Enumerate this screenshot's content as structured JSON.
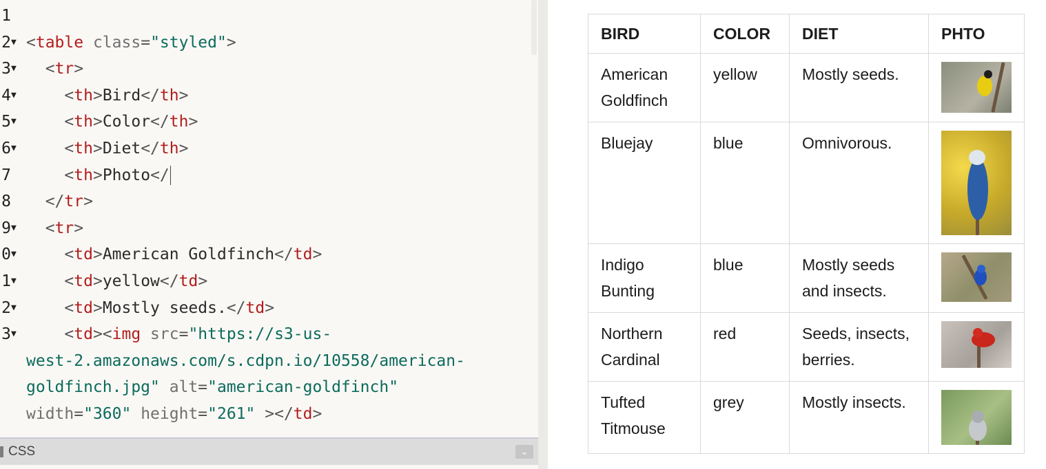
{
  "editor": {
    "lines": [
      {
        "num": "1",
        "fold": false,
        "tokens": []
      },
      {
        "num": "2",
        "fold": true,
        "tokens": [
          [
            "punct",
            "<"
          ],
          [
            "tag",
            "table"
          ],
          [
            "attr",
            " class"
          ],
          [
            "punct",
            "="
          ],
          [
            "str",
            "\"styled\""
          ],
          [
            "punct",
            ">"
          ]
        ]
      },
      {
        "num": "3",
        "fold": true,
        "tokens": [
          [
            "plain",
            "  "
          ],
          [
            "punct",
            "<"
          ],
          [
            "tag",
            "tr"
          ],
          [
            "punct",
            ">"
          ]
        ]
      },
      {
        "num": "4",
        "fold": true,
        "tokens": [
          [
            "plain",
            "    "
          ],
          [
            "punct",
            "<"
          ],
          [
            "tag",
            "th"
          ],
          [
            "punct",
            ">"
          ],
          [
            "plain",
            "Bird"
          ],
          [
            "punct",
            "</"
          ],
          [
            "tag",
            "th"
          ],
          [
            "punct",
            ">"
          ]
        ]
      },
      {
        "num": "5",
        "fold": true,
        "tokens": [
          [
            "plain",
            "    "
          ],
          [
            "punct",
            "<"
          ],
          [
            "tag",
            "th"
          ],
          [
            "punct",
            ">"
          ],
          [
            "plain",
            "Color"
          ],
          [
            "punct",
            "</"
          ],
          [
            "tag",
            "th"
          ],
          [
            "punct",
            ">"
          ]
        ]
      },
      {
        "num": "6",
        "fold": true,
        "tokens": [
          [
            "plain",
            "    "
          ],
          [
            "punct",
            "<"
          ],
          [
            "tag",
            "th"
          ],
          [
            "punct",
            ">"
          ],
          [
            "plain",
            "Diet"
          ],
          [
            "punct",
            "</"
          ],
          [
            "tag",
            "th"
          ],
          [
            "punct",
            ">"
          ]
        ]
      },
      {
        "num": "7",
        "fold": false,
        "cursor": true,
        "tokens": [
          [
            "plain",
            "    "
          ],
          [
            "punct",
            "<"
          ],
          [
            "tag",
            "th"
          ],
          [
            "punct",
            ">"
          ],
          [
            "plain",
            "Photo"
          ],
          [
            "punct",
            "</"
          ]
        ]
      },
      {
        "num": "8",
        "fold": false,
        "tokens": [
          [
            "plain",
            "  "
          ],
          [
            "punct",
            "</"
          ],
          [
            "tag",
            "tr"
          ],
          [
            "punct",
            ">"
          ]
        ]
      },
      {
        "num": "9",
        "fold": true,
        "tokens": [
          [
            "plain",
            "  "
          ],
          [
            "punct",
            "<"
          ],
          [
            "tag",
            "tr"
          ],
          [
            "punct",
            ">"
          ]
        ]
      },
      {
        "num": "0",
        "fold": true,
        "tokens": [
          [
            "plain",
            "    "
          ],
          [
            "punct",
            "<"
          ],
          [
            "tag",
            "td"
          ],
          [
            "punct",
            ">"
          ],
          [
            "plain",
            "American Goldfinch"
          ],
          [
            "punct",
            "</"
          ],
          [
            "tag",
            "td"
          ],
          [
            "punct",
            ">"
          ]
        ]
      },
      {
        "num": "1",
        "fold": true,
        "tokens": [
          [
            "plain",
            "    "
          ],
          [
            "punct",
            "<"
          ],
          [
            "tag",
            "td"
          ],
          [
            "punct",
            ">"
          ],
          [
            "plain",
            "yellow"
          ],
          [
            "punct",
            "</"
          ],
          [
            "tag",
            "td"
          ],
          [
            "punct",
            ">"
          ]
        ]
      },
      {
        "num": "2",
        "fold": true,
        "tokens": [
          [
            "plain",
            "    "
          ],
          [
            "punct",
            "<"
          ],
          [
            "tag",
            "td"
          ],
          [
            "punct",
            ">"
          ],
          [
            "plain",
            "Mostly seeds."
          ],
          [
            "punct",
            "</"
          ],
          [
            "tag",
            "td"
          ],
          [
            "punct",
            ">"
          ]
        ]
      },
      {
        "num": "3",
        "fold": true,
        "tokens": [
          [
            "plain",
            "    "
          ],
          [
            "punct",
            "<"
          ],
          [
            "tag",
            "td"
          ],
          [
            "punct",
            "><"
          ],
          [
            "tag",
            "img"
          ],
          [
            "attr",
            " src"
          ],
          [
            "punct",
            "="
          ],
          [
            "str",
            "\"https://s3-us-"
          ]
        ]
      },
      {
        "num": "",
        "fold": false,
        "tokens": [
          [
            "str",
            "west-2.amazonaws.com/s.cdpn.io/10558/american-"
          ]
        ]
      },
      {
        "num": "",
        "fold": false,
        "tokens": [
          [
            "str",
            "goldfinch.jpg\""
          ],
          [
            "attr",
            " alt"
          ],
          [
            "punct",
            "="
          ],
          [
            "str",
            "\"american-goldfinch\""
          ]
        ]
      },
      {
        "num": "",
        "fold": false,
        "tokens": [
          [
            "attr",
            "width"
          ],
          [
            "punct",
            "="
          ],
          [
            "str",
            "\"360\""
          ],
          [
            "attr",
            " height"
          ],
          [
            "punct",
            "="
          ],
          [
            "str",
            "\"261\""
          ],
          [
            "punct",
            " ></"
          ],
          [
            "tag",
            "td"
          ],
          [
            "punct",
            ">"
          ]
        ]
      }
    ],
    "css_panel_label": "CSS",
    "collapse_icon": "chevron-down-icon"
  },
  "preview": {
    "headers": [
      "BIRD",
      "COLOR",
      "DIET",
      "PHTO"
    ],
    "rows": [
      {
        "bird": "American Goldfinch",
        "color": "yellow",
        "diet": "Mostly seeds.",
        "photo": "american-goldfinch-photo"
      },
      {
        "bird": "Bluejay",
        "color": "blue",
        "diet": "Omnivorous.",
        "photo": "bluejay-photo"
      },
      {
        "bird": "Indigo Bunting",
        "color": "blue",
        "diet": "Mostly seeds and insects.",
        "photo": "indigo-bunting-photo"
      },
      {
        "bird": "Northern Cardinal",
        "color": "red",
        "diet": "Seeds, insects, berries.",
        "photo": "northern-cardinal-photo"
      },
      {
        "bird": "Tufted Titmouse",
        "color": "grey",
        "diet": "Mostly insects.",
        "photo": "tufted-titmouse-photo"
      }
    ]
  },
  "colors": {
    "tag": "#b21d1d",
    "string": "#0c6b5c",
    "attribute": "#707070"
  }
}
